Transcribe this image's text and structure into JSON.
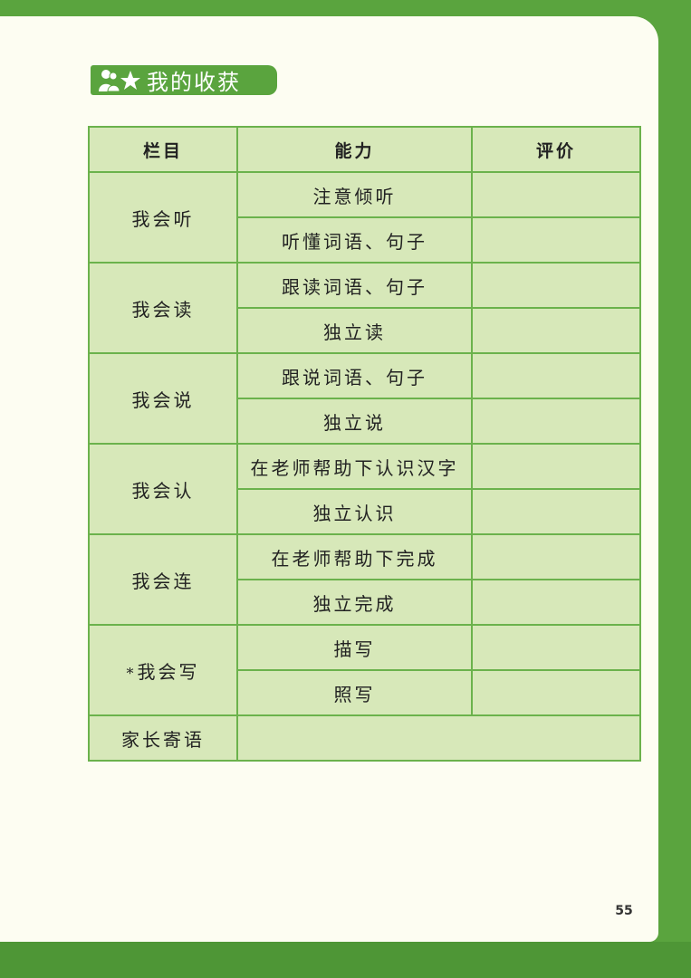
{
  "header": {
    "title": "我的收获",
    "icons": [
      "people-icon",
      "star-icon"
    ]
  },
  "table": {
    "headers": [
      "栏目",
      "能力",
      "评价"
    ],
    "groups": [
      {
        "category": "我会听",
        "abilities": [
          "注意倾听",
          "听懂词语、句子"
        ]
      },
      {
        "category": "我会读",
        "abilities": [
          "跟读词语、句子",
          "独立读"
        ]
      },
      {
        "category": "我会说",
        "abilities": [
          "跟说词语、句子",
          "独立说"
        ]
      },
      {
        "category": "我会认",
        "abilities": [
          "在老师帮助下认识汉字",
          "独立认识"
        ]
      },
      {
        "category": "我会连",
        "abilities": [
          "在老师帮助下完成",
          "独立完成"
        ]
      },
      {
        "category": "我会写",
        "marker": "*",
        "abilities": [
          "描写",
          "照写"
        ]
      }
    ],
    "parent_message_label": "家长寄语"
  },
  "page_number": "55",
  "colors": {
    "accent": "#5aa43e",
    "cell": "#d7e8b9",
    "paper": "#fdfdf2"
  }
}
